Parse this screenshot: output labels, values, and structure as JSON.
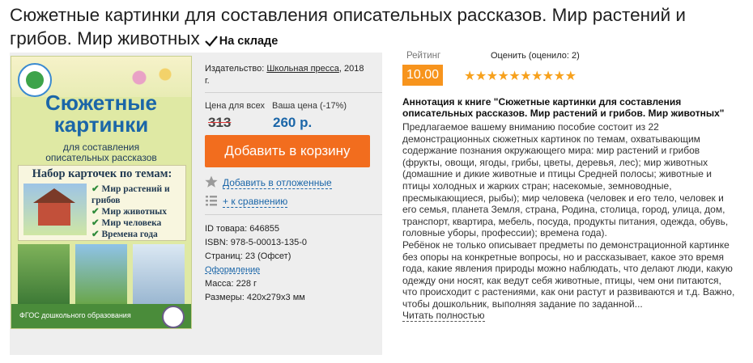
{
  "product": {
    "title": "Сюжетные картинки для составления описательных рассказов. Мир растений и грибов. Мир животных",
    "stock_status": "На складе"
  },
  "cover": {
    "title_line1": "Сюжетные",
    "title_line2": "картинки",
    "subtitle_line1": "для составления",
    "subtitle_line2": "описательных рассказов",
    "box_title": "Набор карточек по темам:",
    "topics": [
      "Мир растений и грибов",
      "Мир животных",
      "Мир человека",
      "Времена года"
    ],
    "footer": "ФГОС дошкольного образования"
  },
  "publisher": {
    "label": "Издательство:",
    "name": "Школьная пресса",
    "year": ", 2018 г."
  },
  "price": {
    "old_label": "Цена для всех",
    "new_label": "Ваша цена (-17%)",
    "old_value": "313",
    "new_value": "260 р."
  },
  "actions": {
    "add_to_cart": "Добавить в корзину",
    "wishlist": "Добавить в отложенные",
    "compare": "+ к сравнению"
  },
  "details": {
    "id": "ID товара: 646855",
    "isbn": "ISBN: 978-5-00013-135-0",
    "pages": "Страниц: 23 (Офсет)",
    "design_link": "Оформление",
    "weight": "Масса: 228 г",
    "size": "Размеры: 420x279x3 мм"
  },
  "rating": {
    "label": "Рейтинг",
    "value": "10.00",
    "rate_label": "Оценить (оценило: 2)",
    "stars": 10
  },
  "annotation": {
    "title": "Аннотация к книге \"Сюжетные картинки для составления описательных рассказов. Мир растений и грибов. Мир животных\"",
    "paragraph1": "Предлагаемое вашему вниманию пособие состоит из 22 демонстрационных сюжетных картинок по темам, охватывающим содержание познания окружающего мира: мир растений и грибов (фрукты, овощи, ягоды, грибы, цветы, деревья, лес); мир животных (домашние и дикие животные и птицы Средней полосы; животные и птицы холодных и жарких стран; насекомые, земноводные, пресмыкающиеся, рыбы); мир человека (человек и его тело, человек и его семья, планета Земля, страна, Родина, столица, город, улица, дом, транспорт, квартира, мебель, посуда, продукты питания, одежда, обувь, головные уборы, профессии); времена года).",
    "paragraph2": "Ребёнок не только описывает предметы по демонстрационной картинке без опоры на конкретные вопросы, но и рассказывает, какое это время года, какие явления природы можно наблюдать, что делают люди, какую одежду они носят, как ведут себя животные, птицы, чем они питаются, что происходит с растениями, как они растут и развиваются и т.д. Важно, чтобы дошкольник, выполняя задание по заданной...",
    "read_more": "Читать полностью"
  },
  "colors": {
    "accent_orange": "#f26d1e",
    "rating_orange": "#f7941d",
    "link_blue": "#1b66a8",
    "panel_bg": "#eeeeee"
  }
}
